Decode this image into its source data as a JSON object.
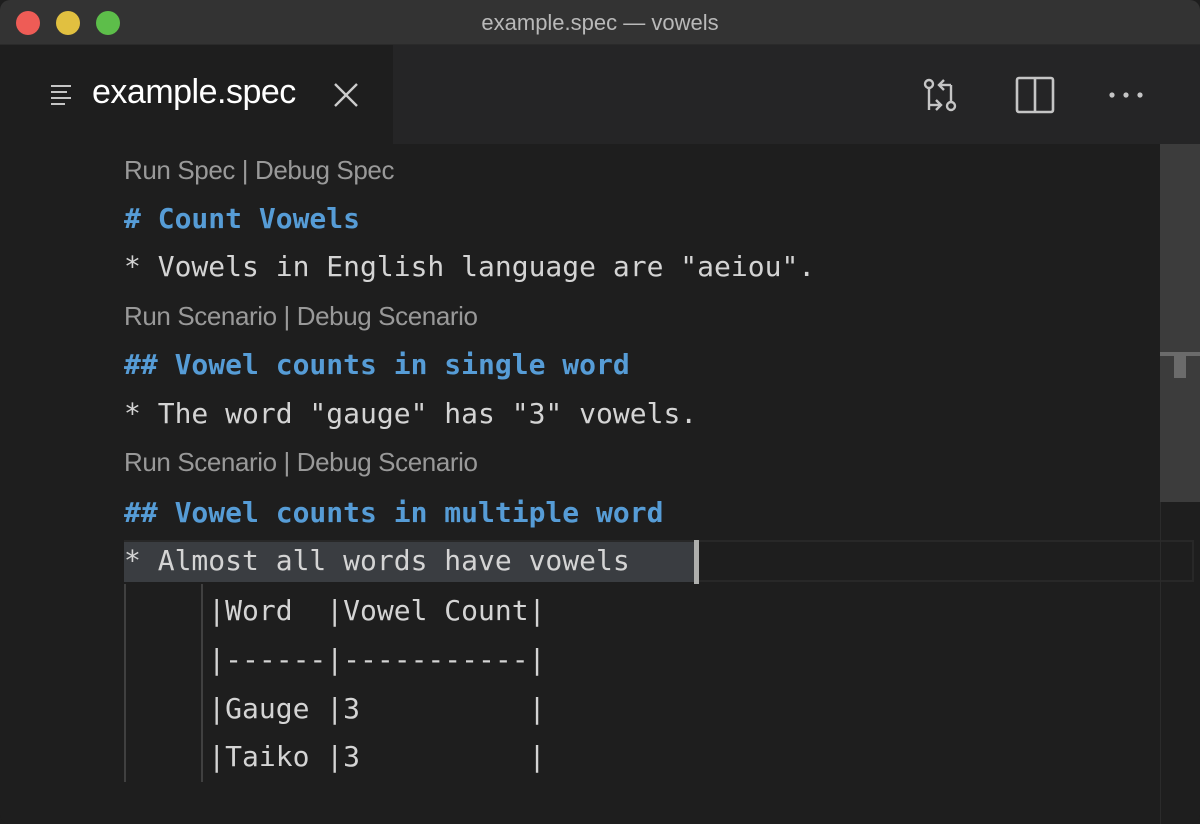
{
  "window": {
    "title": "example.spec — vowels"
  },
  "tab": {
    "label": "example.spec"
  },
  "editor": {
    "lines": [
      {
        "kind": "lens",
        "text": "Run Spec | Debug Spec"
      },
      {
        "kind": "heading",
        "text": "# Count Vowels"
      },
      {
        "kind": "code",
        "text": "* Vowels in English language are \"aeiou\"."
      },
      {
        "kind": "lens",
        "text": "Run Scenario | Debug Scenario"
      },
      {
        "kind": "heading",
        "text": "## Vowel counts in single word"
      },
      {
        "kind": "code",
        "text": "* The word \"gauge\" has \"3\" vowels."
      },
      {
        "kind": "lens",
        "text": "Run Scenario | Debug Scenario"
      },
      {
        "kind": "heading",
        "text": "## Vowel counts in multiple word"
      },
      {
        "kind": "code",
        "text": "* Almost all words have vowels"
      },
      {
        "kind": "code",
        "text": "     |Word  |Vowel Count|"
      },
      {
        "kind": "code",
        "text": "     |------|-----------|"
      },
      {
        "kind": "code",
        "text": "     |Gauge |3          |"
      },
      {
        "kind": "code",
        "text": "     |Taiko |3          |"
      }
    ]
  },
  "colors": {
    "heading": "#569cd6",
    "text": "#d4d4d4",
    "codelens": "#999999",
    "background": "#1e1e1e"
  },
  "icons": {
    "tab": "list-icon",
    "close": "close-icon",
    "scm": "source-control-icon",
    "split": "split-editor-icon",
    "more": "more-actions-icon"
  }
}
